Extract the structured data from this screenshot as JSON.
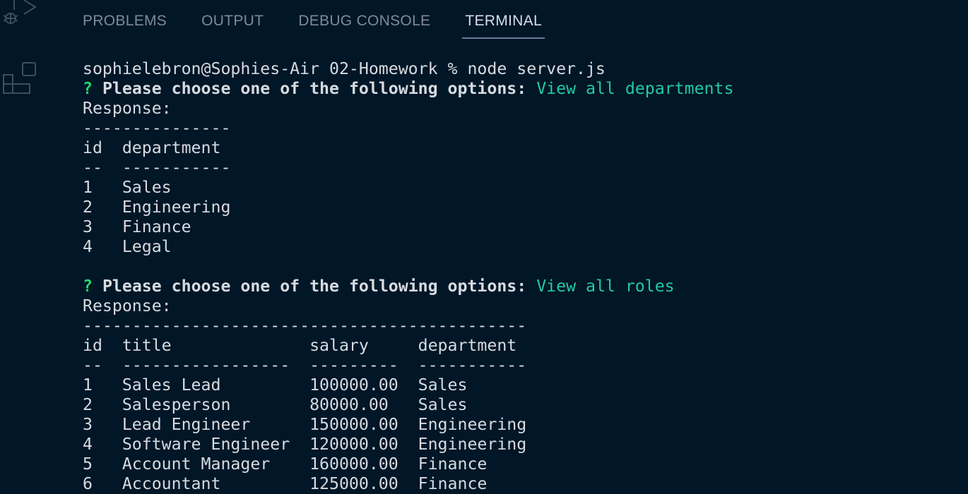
{
  "panel": {
    "tabs": [
      {
        "label": "PROBLEMS",
        "active": false
      },
      {
        "label": "OUTPUT",
        "active": false
      },
      {
        "label": "DEBUG CONSOLE",
        "active": false
      },
      {
        "label": "TERMINAL",
        "active": true
      }
    ]
  },
  "colors": {
    "background": "#011627",
    "prompt_marker": "#22da6e",
    "answer": "#22c9a6"
  },
  "terminal": {
    "lines": [
      {
        "kind": "text",
        "text": "sophielebron@Sophies-Air 02-Homework % node server.js"
      },
      {
        "kind": "prompt",
        "marker": "?",
        "question": "Please choose one of the following options:",
        "answer": "View all departments"
      },
      {
        "kind": "text",
        "text": "Response:"
      },
      {
        "kind": "text",
        "text": "---------------"
      },
      {
        "kind": "text",
        "text": "id  department"
      },
      {
        "kind": "text",
        "text": "--  -----------"
      },
      {
        "kind": "text",
        "text": "1   Sales"
      },
      {
        "kind": "text",
        "text": "2   Engineering"
      },
      {
        "kind": "text",
        "text": "3   Finance"
      },
      {
        "kind": "text",
        "text": "4   Legal"
      },
      {
        "kind": "text",
        "text": ""
      },
      {
        "kind": "prompt",
        "marker": "?",
        "question": "Please choose one of the following options:",
        "answer": "View all roles"
      },
      {
        "kind": "text",
        "text": "Response:"
      },
      {
        "kind": "text",
        "text": "---------------------------------------------"
      },
      {
        "kind": "text",
        "text": "id  title              salary     department"
      },
      {
        "kind": "text",
        "text": "--  -----------------  ---------  -----------"
      },
      {
        "kind": "text",
        "text": "1   Sales Lead         100000.00  Sales"
      },
      {
        "kind": "text",
        "text": "2   Salesperson        80000.00   Sales"
      },
      {
        "kind": "text",
        "text": "3   Lead Engineer      150000.00  Engineering"
      },
      {
        "kind": "text",
        "text": "4   Software Engineer  120000.00  Engineering"
      },
      {
        "kind": "text",
        "text": "5   Account Manager    160000.00  Finance"
      },
      {
        "kind": "text",
        "text": "6   Accountant         125000.00  Finance"
      }
    ]
  }
}
